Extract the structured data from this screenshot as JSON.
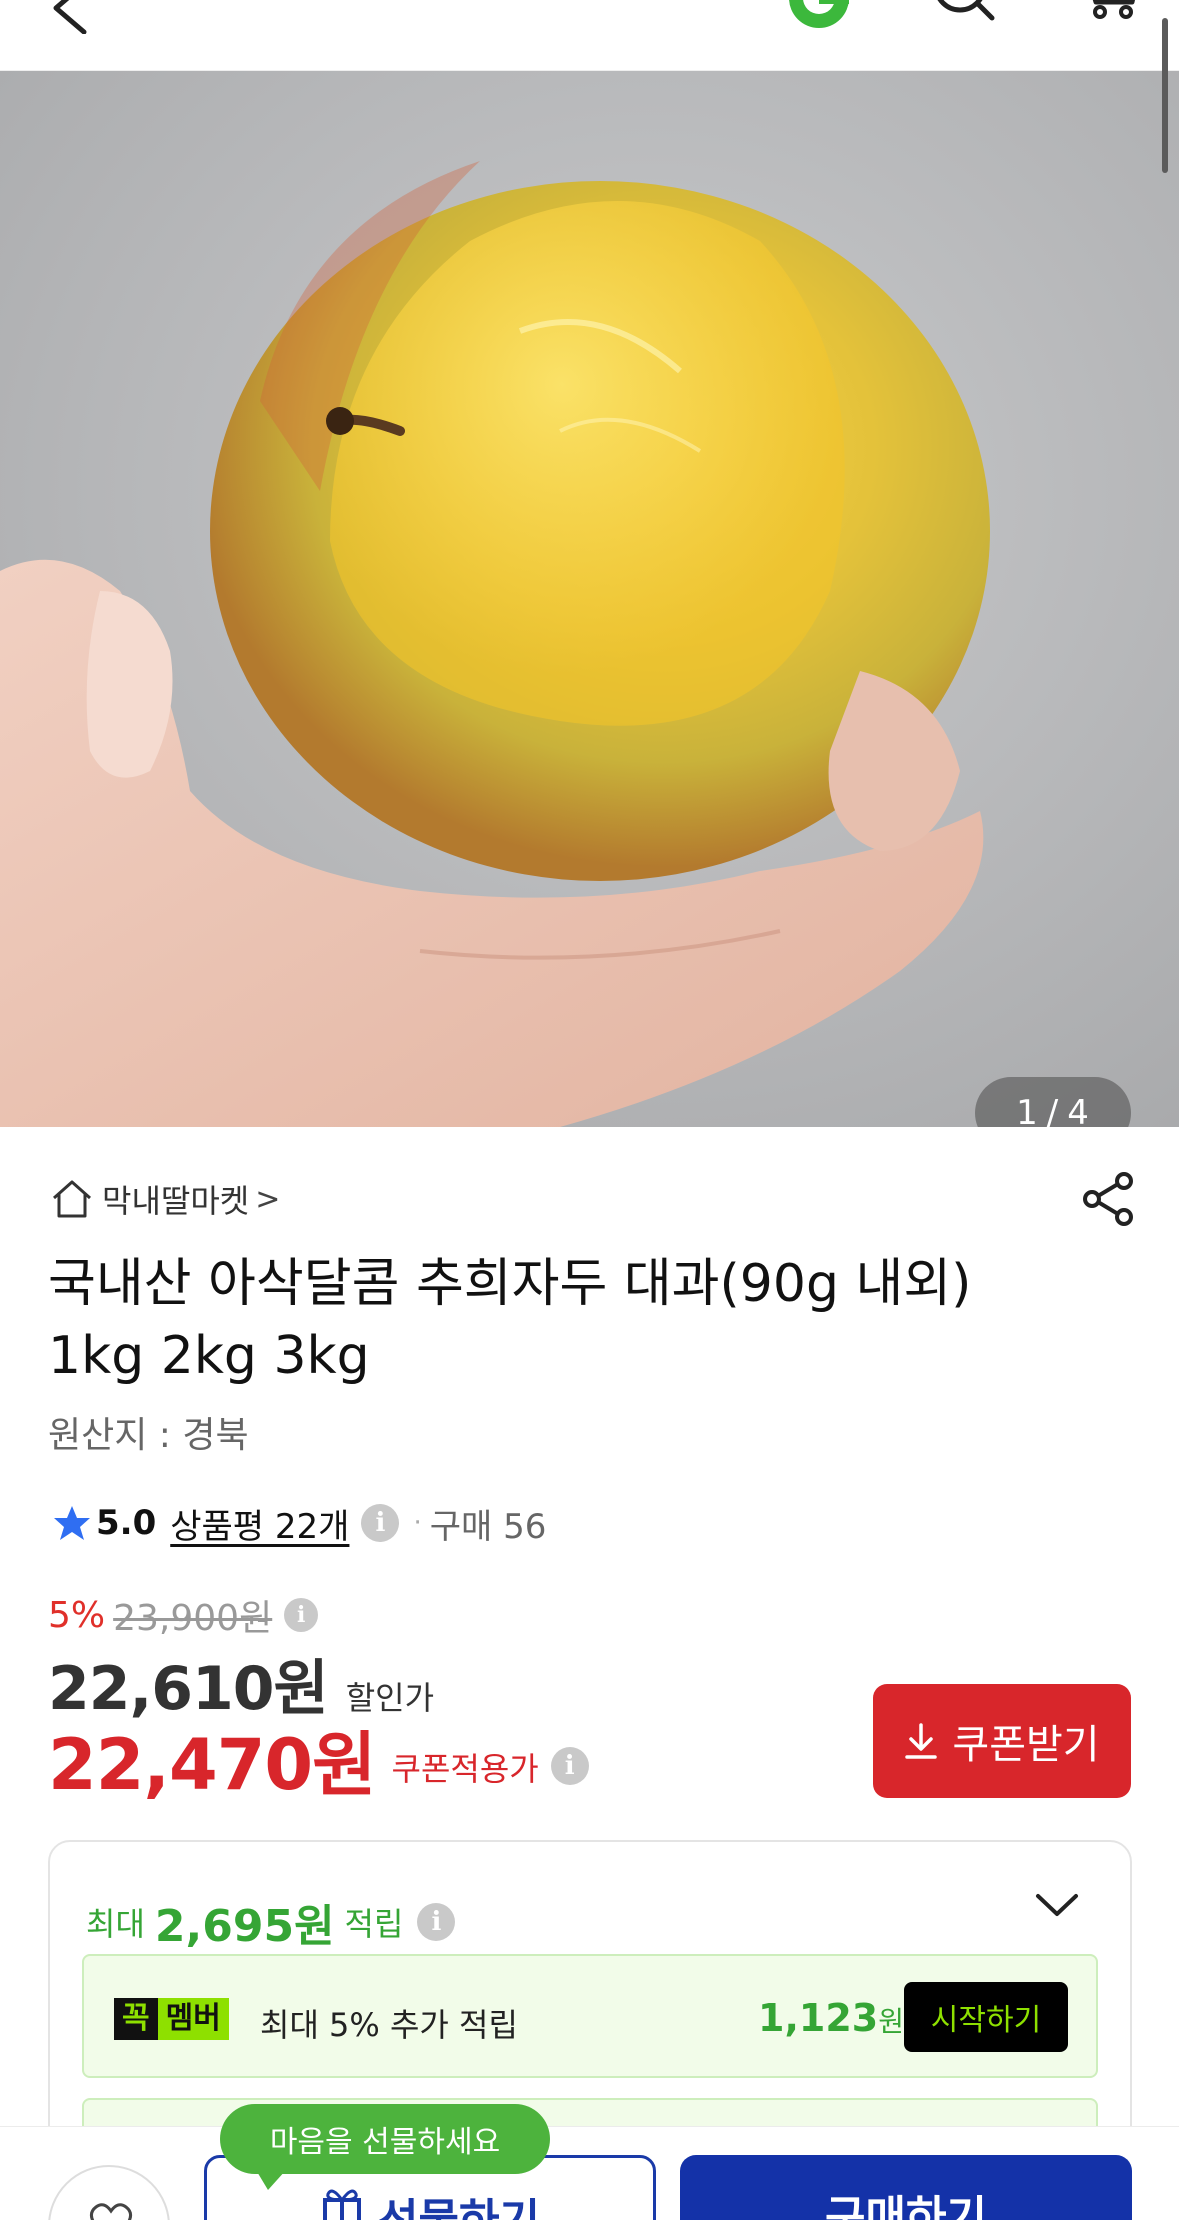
{
  "header": {
    "back_icon": "chevron-left-icon",
    "logo_icon": "g-logo-icon",
    "search_icon": "search-icon",
    "cart_icon": "cart-icon"
  },
  "gallery": {
    "current": "1",
    "separator": "/",
    "total": "4"
  },
  "product": {
    "store_name": "막내딸마켓",
    "store_chevron": ">",
    "title": "국내산 아삭달콤 추희자두 대과(90g 내외) 1kg 2kg 3kg",
    "origin": "원산지 : 경북",
    "rating": "5.0",
    "reviews": "상품평 22개",
    "purchases": "구매 56",
    "discount_pct": "5%",
    "original_price": "23,900원",
    "sale_price": "22,610원",
    "sale_label": "할인가",
    "coupon_price": "22,470원",
    "coupon_label": "쿠폰적용가",
    "coupon_button": "쿠폰받기"
  },
  "points": {
    "prefix": "최대",
    "amount": "2,695원",
    "suffix": "적립",
    "member_badge_1": "꼭",
    "member_badge_2": "멤버",
    "member_text": "최대 5% 추가 적립",
    "member_amount": "1,123",
    "member_amount_unit": "원",
    "member_button": "시작하기"
  },
  "bottom": {
    "tooltip": "마음을 선물하세요",
    "gift_button": "선물하기",
    "buy_button": "구매하기"
  },
  "colors": {
    "accent_red": "#d8262b",
    "accent_green": "#35a535",
    "brand_blue": "#1432a8",
    "member_green": "#8ee000"
  }
}
